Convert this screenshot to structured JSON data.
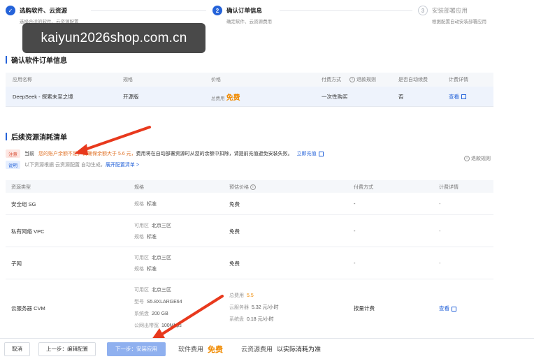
{
  "watermark": "kaiyun2026shop.com.cn",
  "steps": [
    {
      "number": "",
      "title": "选购软件、云资源",
      "desc": "选择合适的软件、云资源配置",
      "state": "done"
    },
    {
      "number": "2",
      "title": "确认订单信息",
      "desc": "确定软件、云资源费用",
      "state": "active"
    },
    {
      "number": "3",
      "title": "安装部署应用",
      "desc": "根据配置自动安装部署应用",
      "state": "todo"
    }
  ],
  "section1": {
    "title": "确认软件订单信息"
  },
  "table1": {
    "headers": {
      "name": "应用名称",
      "spec": "规格",
      "price": "价格",
      "pay": "付费方式",
      "refund": "退款规则",
      "renew": "是否自动续费",
      "detail": "计费详情"
    },
    "row": {
      "name": "DeepSeek - 探索未至之境",
      "spec": "开源版",
      "price_label": "总费用",
      "price": "免费",
      "pay": "一次性购买",
      "renew": "否",
      "detail": "查看"
    }
  },
  "section2": {
    "title": "后续资源消耗清单"
  },
  "notice": {
    "warn_tag": "注意",
    "warn_pre": "当前",
    "warn_highlight": "您的账户余额不足，请确保余额大于 5.6 元，",
    "warn_rest": "费用将在自动部署资源时从您的余额中扣除，请提前充值避免安装失败。",
    "warn_link": "立即充值",
    "info_tag": "说明",
    "info_text": "以下资源根据 云资源配置 自动生成，",
    "info_link": "展开配置清单 >",
    "refund_rule": "退款规则"
  },
  "table2": {
    "headers": {
      "type": "资源类型",
      "spec": "规格",
      "price": "预估价格",
      "pay": "付费方式",
      "detail": "计费详情"
    },
    "rows": [
      {
        "type": "安全组 SG",
        "specs": [
          {
            "k": "规格",
            "v": "标准"
          }
        ],
        "price": "免费",
        "pay": "-",
        "detail": "-"
      },
      {
        "type": "私有网络 VPC",
        "specs": [
          {
            "k": "可用区",
            "v": "北京三区"
          },
          {
            "k": "规格",
            "v": "标准"
          }
        ],
        "price": "免费",
        "pay": "-",
        "detail": "-"
      },
      {
        "type": "子网",
        "specs": [
          {
            "k": "可用区",
            "v": "北京三区"
          },
          {
            "k": "规格",
            "v": "标准"
          }
        ],
        "price": "免费",
        "pay": "-",
        "detail": "-"
      },
      {
        "type": "云服务器 CVM",
        "specs": [
          {
            "k": "可用区",
            "v": "北京三区"
          },
          {
            "k": "型号",
            "v": "S5.8XLARGE64"
          },
          {
            "k": "系统盘",
            "v": "200 GB"
          },
          {
            "k": "公网出带宽",
            "v": "100Mbps"
          }
        ],
        "price_lines": [
          {
            "k": "总费用",
            "v": "5.5"
          },
          {
            "k": "云服务器",
            "v": "5.32 元/小时"
          },
          {
            "k": "系统盘",
            "v": "0.18 元/小时"
          }
        ],
        "pay": "按量计费",
        "detail": "查看"
      }
    ]
  },
  "footer": {
    "cancel": "取消",
    "prev": "上一步：编辑配置",
    "next": "下一步：安装应用",
    "software_fee_label": "软件费用",
    "software_fee": "免费",
    "cloud_fee_label": "云资源费用",
    "cloud_fee": "以实际消耗为准"
  }
}
